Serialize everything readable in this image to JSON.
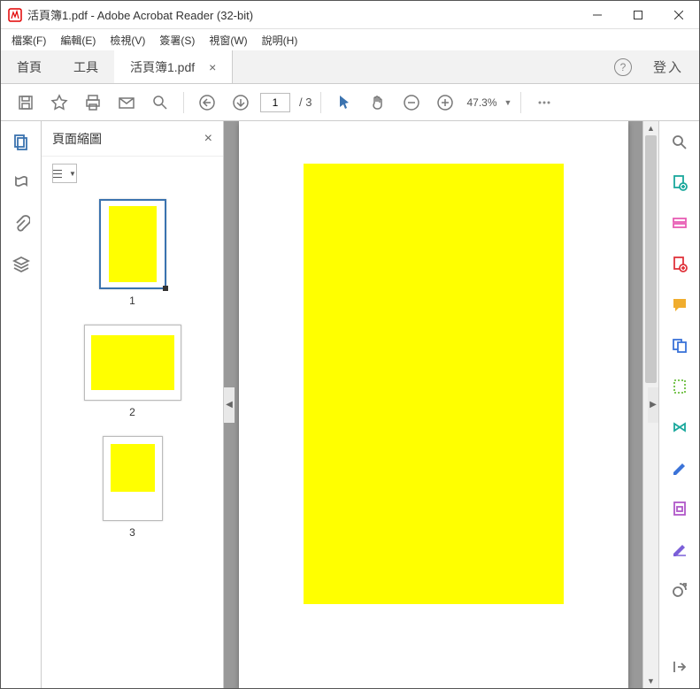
{
  "titlebar": {
    "title": "活頁簿1.pdf - Adobe Acrobat Reader (32-bit)"
  },
  "menu": {
    "items": [
      "檔案(F)",
      "編輯(E)",
      "檢視(V)",
      "簽署(S)",
      "視窗(W)",
      "說明(H)"
    ]
  },
  "tabs": {
    "home": "首頁",
    "tools": "工具",
    "doc": "活頁簿1.pdf",
    "signin": "登入"
  },
  "toolbar": {
    "page_current": "1",
    "page_total": "/ 3",
    "zoom": "47.3%"
  },
  "thumb_panel": {
    "title": "頁面縮圖",
    "pages": [
      "1",
      "2",
      "3"
    ]
  }
}
